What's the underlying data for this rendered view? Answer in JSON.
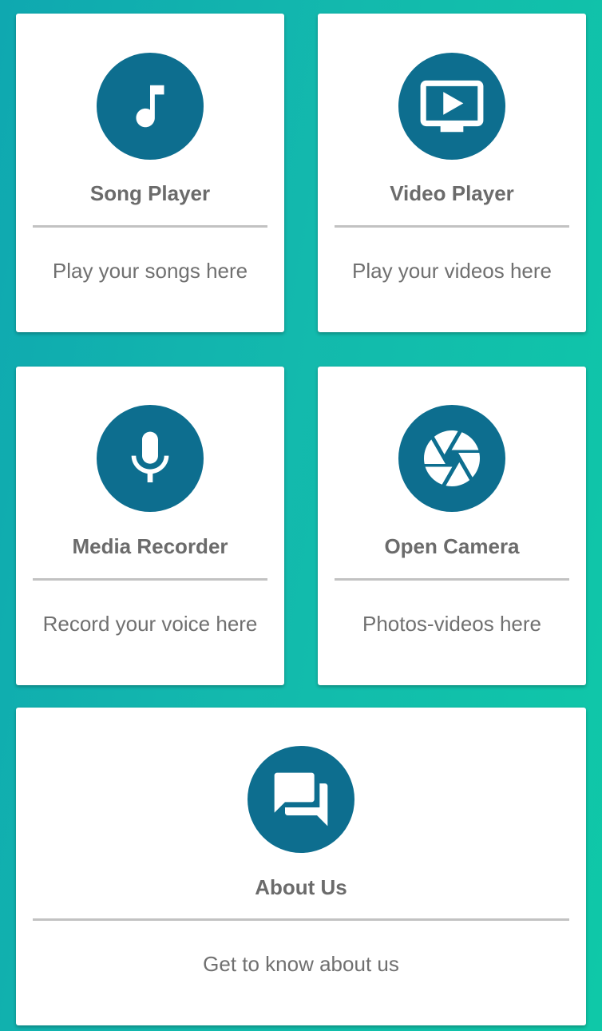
{
  "cards": [
    {
      "title": "Song Player",
      "description": "Play your songs here",
      "icon": "music-note-icon"
    },
    {
      "title": "Video Player",
      "description": "Play your videos here",
      "icon": "tv-play-icon"
    },
    {
      "title": "Media Recorder",
      "description": "Record your voice here",
      "icon": "microphone-icon"
    },
    {
      "title": "Open Camera",
      "description": "Photos-videos here",
      "icon": "camera-shutter-icon"
    },
    {
      "title": "About Us",
      "description": "Get to know about us",
      "icon": "chat-bubbles-icon"
    }
  ],
  "colors": {
    "icon_circle": "#0d6e8f",
    "card_background": "#ffffff",
    "title_text": "#6b6b6b",
    "description_text": "#707070",
    "divider": "#c2c2c2",
    "background_gradient_start": "#0fa8b0",
    "background_gradient_end": "#0fc8a8"
  }
}
